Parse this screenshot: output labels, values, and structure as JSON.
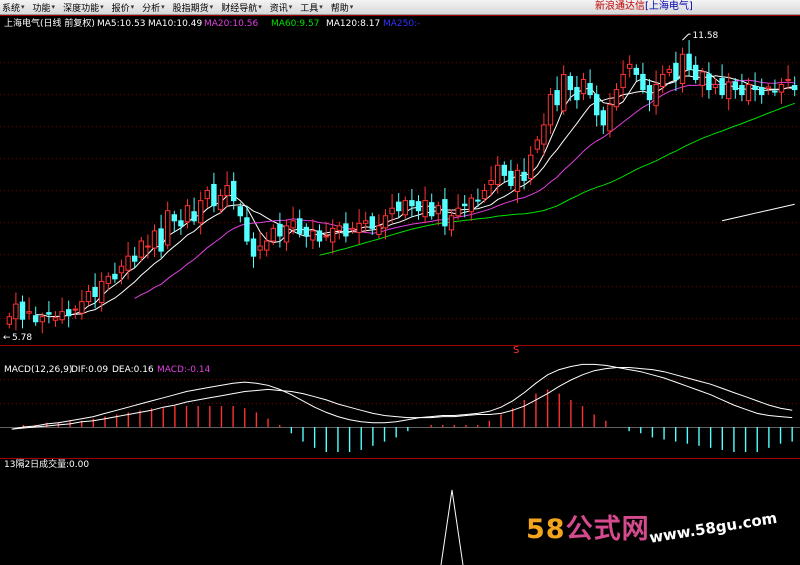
{
  "menu": [
    {
      "label": "系统"
    },
    {
      "label": "功能"
    },
    {
      "label": "深度功能"
    },
    {
      "label": "报价"
    },
    {
      "label": "分析"
    },
    {
      "label": "股指期货"
    },
    {
      "label": "财经导航"
    },
    {
      "label": "资讯"
    },
    {
      "label": "工具"
    },
    {
      "label": "帮助"
    }
  ],
  "brand": {
    "name": "新浪通达信",
    "stock": "[上海电气]"
  },
  "main_panel": {
    "title": "上海电气(日线 前复权)",
    "ma_labels": [
      {
        "text": "MA5:10.53",
        "color": "#ffffff"
      },
      {
        "text": "MA10:10.49",
        "color": "#ffffff"
      },
      {
        "text": "MA20:10.56",
        "color": "#e040e0"
      },
      {
        "text": "MA60:9.57",
        "color": "#00e000"
      },
      {
        "text": "MA120:8.17",
        "color": "#ffffff"
      },
      {
        "text": "MA250:-",
        "color": "#3030ff"
      }
    ],
    "high_label": "11.58",
    "low_label": "5.78",
    "mark": "S"
  },
  "macd_panel": {
    "title": "MACD(12,26,9)",
    "labels": [
      {
        "text": "DIF:0.09",
        "color": "#ffffff"
      },
      {
        "text": "DEA:0.16",
        "color": "#ffffff"
      },
      {
        "text": "MACD:-0.14",
        "color": "#e040e0"
      }
    ]
  },
  "vol_panel": {
    "title": "13隔2日成交量",
    "value": ":0.00"
  },
  "watermark": {
    "logo_num": "58",
    "logo_text": "公式网",
    "url": "www.58gu.com"
  },
  "colors": {
    "up": "#ff3232",
    "down": "#54ffff",
    "axis": "#a00000"
  },
  "chart_data": [
    {
      "type": "candlestick",
      "title": "上海电气(日线 前复权)",
      "ylim": [
        5.5,
        11.8
      ],
      "series": [
        {
          "name": "MA5",
          "last": 10.53
        },
        {
          "name": "MA10",
          "last": 10.49
        },
        {
          "name": "MA20",
          "last": 10.56
        },
        {
          "name": "MA60",
          "last": 9.57
        },
        {
          "name": "MA120",
          "last": 8.17
        },
        {
          "name": "MA250",
          "last": null
        }
      ],
      "annotations": [
        {
          "label": "11.58",
          "type": "high"
        },
        {
          "label": "5.78",
          "type": "low"
        }
      ],
      "close": [
        6.1,
        6.35,
        6.05,
        6.2,
        6.0,
        6.1,
        6.15,
        6.08,
        6.2,
        6.12,
        6.25,
        6.4,
        6.6,
        6.5,
        6.8,
        6.9,
        6.85,
        7.1,
        7.3,
        7.2,
        7.6,
        7.5,
        7.8,
        7.4,
        8.2,
        8.0,
        7.9,
        8.3,
        8.0,
        8.4,
        8.6,
        8.3,
        8.5,
        8.7,
        8.4,
        8.1,
        7.6,
        7.3,
        7.5,
        7.6,
        7.85,
        7.7,
        7.9,
        8.0,
        7.75,
        7.7,
        7.8,
        7.6,
        7.7,
        7.85,
        7.9,
        7.7,
        7.85,
        7.95,
        8.0,
        7.85,
        7.9,
        8.1,
        8.25,
        8.2,
        8.4,
        8.3,
        8.2,
        8.4,
        8.1,
        8.3,
        7.9,
        8.1,
        8.25,
        8.3,
        8.45,
        8.4,
        8.6,
        8.8,
        9.1,
        8.9,
        8.7,
        9.0,
        8.8,
        9.3,
        9.6,
        9.9,
        10.5,
        10.3,
        10.9,
        10.6,
        10.4,
        10.8,
        10.5,
        10.1,
        9.9,
        10.3,
        10.6,
        10.9,
        11.1,
        10.9,
        10.6,
        10.4,
        10.7,
        10.9,
        11.0,
        10.8,
        11.3,
        11.0,
        10.8,
        10.95,
        10.6,
        10.7,
        10.5,
        10.75,
        10.6,
        10.5,
        10.7,
        10.6,
        10.5,
        10.65,
        10.55,
        10.7,
        10.8,
        10.6
      ]
    },
    {
      "type": "macd",
      "title": "MACD(12,26,9)",
      "series": [
        {
          "name": "DIF",
          "last": 0.09
        },
        {
          "name": "DEA",
          "last": 0.16
        },
        {
          "name": "MACD",
          "last": -0.14
        }
      ],
      "dif": [
        -0.02,
        0.0,
        0.01,
        0.03,
        0.04,
        0.06,
        0.08,
        0.1,
        0.13,
        0.16,
        0.19,
        0.22,
        0.25,
        0.28,
        0.31,
        0.34,
        0.36,
        0.38,
        0.4,
        0.42,
        0.43,
        0.42,
        0.4,
        0.36,
        0.31,
        0.25,
        0.19,
        0.14,
        0.1,
        0.07,
        0.05,
        0.04,
        0.04,
        0.05,
        0.07,
        0.09,
        0.1,
        0.11,
        0.11,
        0.12,
        0.13,
        0.15,
        0.19,
        0.25,
        0.33,
        0.42,
        0.5,
        0.55,
        0.58,
        0.6,
        0.6,
        0.59,
        0.57,
        0.55,
        0.53,
        0.5,
        0.47,
        0.43,
        0.39,
        0.35,
        0.31,
        0.26,
        0.21,
        0.17,
        0.13,
        0.11,
        0.1,
        0.09
      ],
      "dea": [
        -0.02,
        -0.01,
        0.0,
        0.01,
        0.02,
        0.03,
        0.05,
        0.06,
        0.08,
        0.1,
        0.12,
        0.14,
        0.16,
        0.19,
        0.21,
        0.24,
        0.26,
        0.28,
        0.3,
        0.32,
        0.34,
        0.35,
        0.36,
        0.35,
        0.34,
        0.32,
        0.29,
        0.26,
        0.22,
        0.19,
        0.16,
        0.13,
        0.11,
        0.1,
        0.09,
        0.09,
        0.09,
        0.1,
        0.1,
        0.11,
        0.12,
        0.12,
        0.13,
        0.16,
        0.2,
        0.26,
        0.32,
        0.39,
        0.45,
        0.5,
        0.54,
        0.56,
        0.57,
        0.57,
        0.56,
        0.55,
        0.53,
        0.5,
        0.47,
        0.44,
        0.41,
        0.37,
        0.33,
        0.29,
        0.25,
        0.21,
        0.18,
        0.16
      ],
      "ylim": [
        -0.28,
        0.64
      ]
    },
    {
      "type": "volume-indicator",
      "title": "13隔2日成交量",
      "values": [
        0.0,
        1.0,
        0.0
      ],
      "x": [
        0.0,
        0.5,
        1.0
      ]
    }
  ]
}
